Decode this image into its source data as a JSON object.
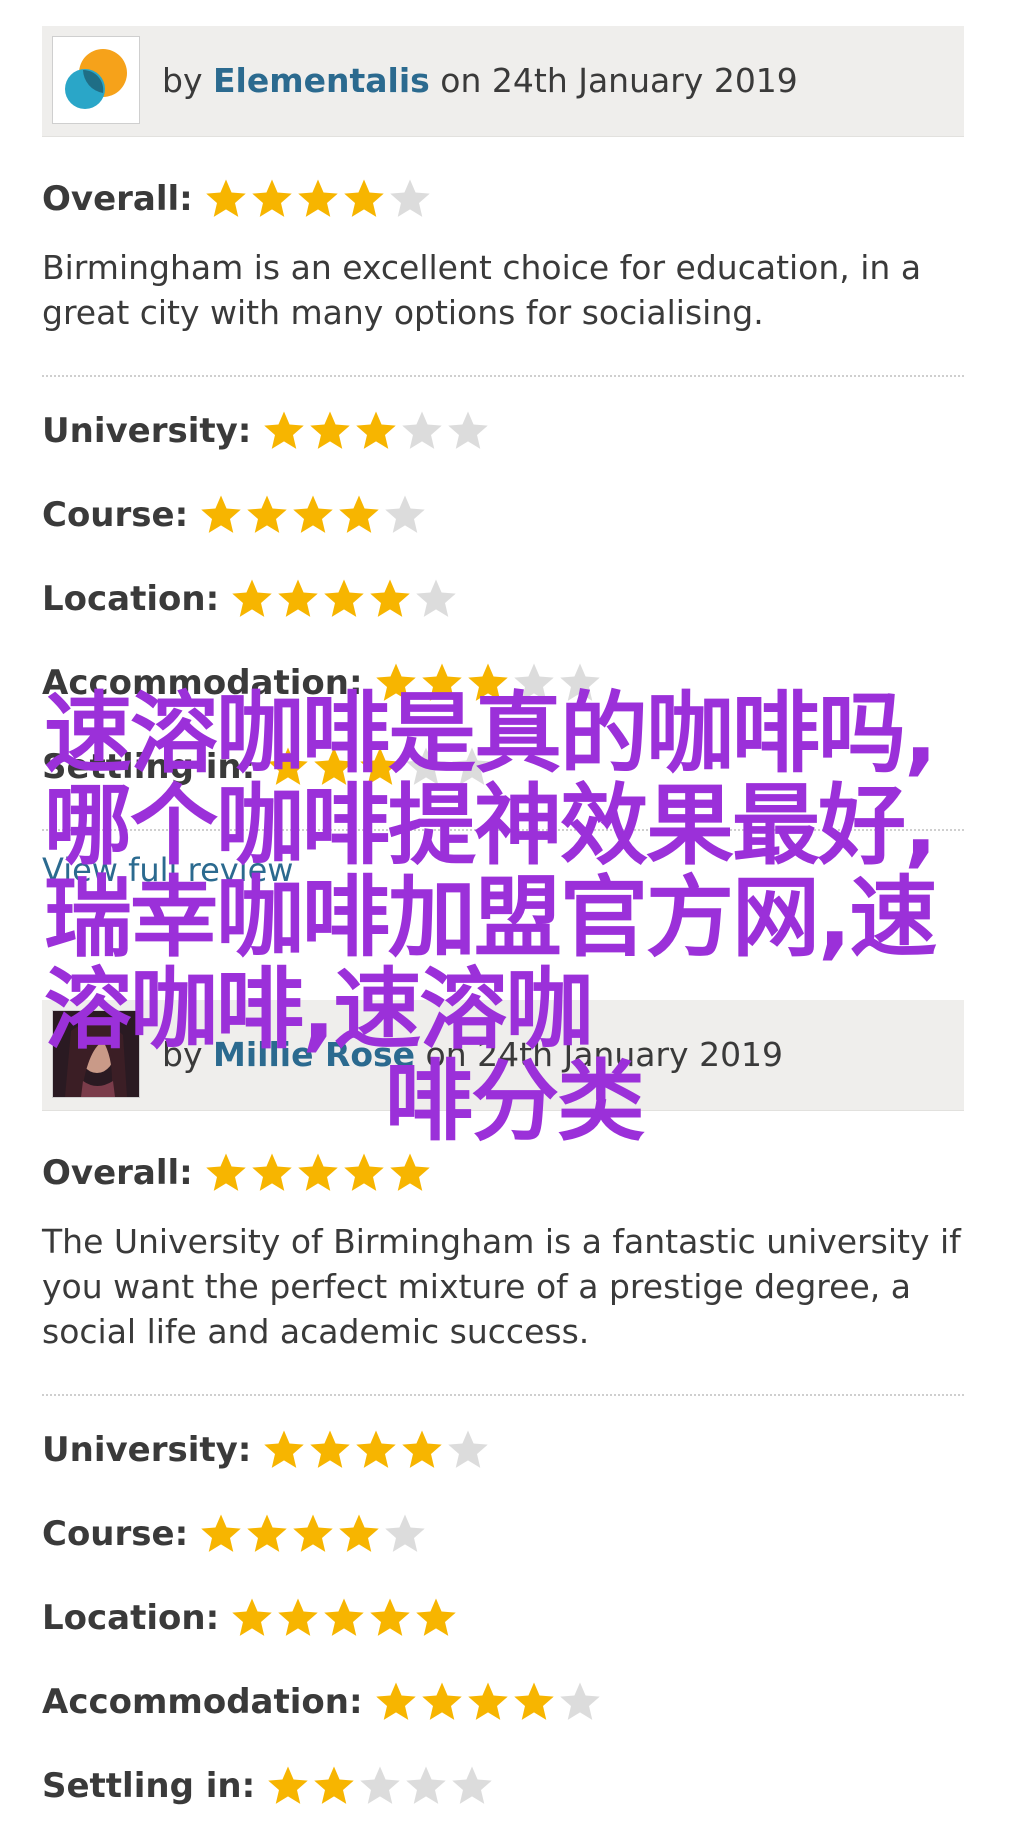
{
  "reviews": [
    {
      "by_prefix": "by",
      "author": "Elementalis",
      "date_text": "on 24th January 2019",
      "overall_label": "Overall:",
      "overall_rating": 4,
      "text": "Birmingham is an excellent choice for education, in a great city with many options for socialising.",
      "categories": [
        {
          "label": "University:",
          "rating": 3
        },
        {
          "label": "Course:",
          "rating": 4
        },
        {
          "label": "Location:",
          "rating": 4
        },
        {
          "label": "Accommodation:",
          "rating": 3
        },
        {
          "label": "Settling in:",
          "rating": 3
        }
      ],
      "view_link": "View full review"
    },
    {
      "by_prefix": "by",
      "author": "Millie Rose",
      "date_text": "on 24th January 2019",
      "overall_label": "Overall:",
      "overall_rating": 5,
      "text": "The University of Birmingham is a fantastic university if you want the perfect mixture of a prestige degree, a social life and academic success.",
      "categories": [
        {
          "label": "University:",
          "rating": 4
        },
        {
          "label": "Course:",
          "rating": 4
        },
        {
          "label": "Location:",
          "rating": 5
        },
        {
          "label": "Accommodation:",
          "rating": 4
        },
        {
          "label": "Settling in:",
          "rating": 2
        }
      ]
    }
  ],
  "overlay": {
    "text_main": "速溶咖啡是真的咖啡吗,哪个咖啡提神效果最好,瑞幸咖啡加盟官方网,速溶咖啡,速溶咖",
    "text_last": "啡分类"
  },
  "colors": {
    "star_filled": "#f7b500",
    "star_empty": "#dcdcdc",
    "author": "#2b6a8f",
    "overlay": "#9b30d9"
  },
  "icons": {
    "avatar1": "logo-avatar-icon",
    "avatar2": "photo-avatar-icon",
    "star": "star-icon"
  }
}
